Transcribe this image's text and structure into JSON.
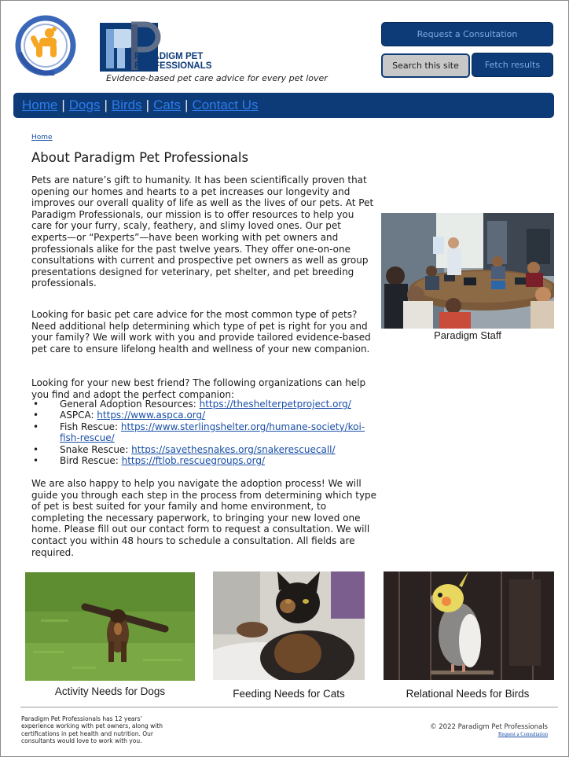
{
  "header": {
    "brand_line1": "PARADIGM PET",
    "brand_line2": "PROFESSIONALS",
    "tagline": "Evidence-based pet care advice for every pet lover",
    "request_button": "Request a Consultation",
    "search_button": "Search this site",
    "fetch_button": "Fetch results"
  },
  "nav": {
    "items": [
      "Home",
      "Dogs",
      "Birds",
      "Cats",
      "Contact Us"
    ],
    "separator": "|"
  },
  "main": {
    "breadcrumb": "Home",
    "title": "About Paradigm Pet Professionals",
    "paragraph1": "Pets are nature’s gift to humanity. It has been scientifically proven that opening our homes and hearts to a pet increases our longevity and improves our overall quality of life as well as the lives of our pets. At Pet Paradigm Professionals, our mission is to offer resources to help you care for your furry, scaly, feathery, and slimy loved ones. Our pet experts—or “Pexperts”—have been working with pet owners and professionals alike for the past twelve years. They offer one-on-one consultations with current and prospective pet owners as well as group presentations designed for veterinary, pet shelter, and pet breeding professionals.",
    "paragraph2": "Looking for basic pet care advice for the most common type of pets? Need additional help determining which type of pet is right for you and your family? We will work with you and provide tailored evidence-based pet care to ensure lifelong health and wellness of your new companion.",
    "paragraph3": "Looking for your new best friend? The following organizations can help you find and adopt the perfect companion:",
    "bullet": "•",
    "organizations": [
      {
        "label": "General Adoption Resources: ",
        "url": "https://theshelterpetproject.org/"
      },
      {
        "label": "ASPCA: ",
        "url": "https://www.aspca.org/"
      },
      {
        "label": "Fish Rescue: ",
        "url": "https://www.sterlingshelter.org/humane-society/koi-fish-rescue/"
      },
      {
        "label": "Snake Rescue: ",
        "url": "https://savethesnakes.org/snakerescuecall/"
      },
      {
        "label": "Bird Rescue: ",
        "url": "https://ftlob.rescuegroups.org/"
      }
    ],
    "paragraph4": "We are also happy to help you navigate the adoption process! We will guide you through each step in the process from determining which type of pet is best suited for your family and home environment, to completing the necessary paperwork, to bringing your new loved one home. Please fill out our contact form to request a consultation. We will contact you within 48 hours to schedule a consultation. All fields are required."
  },
  "staff": {
    "caption": "Paradigm Staff"
  },
  "gallery": {
    "dogs_caption": "Activity Needs for Dogs",
    "cats_caption": "Feeding Needs for Cats",
    "birds_caption": "Relational Needs for Birds"
  },
  "footer": {
    "about": "Paradigm Pet Professionals has 12 years’ experience working with pet owners, along with certifications in pet health and nutrition. Our consultants would love to work with you.",
    "copyright": "© 2022 Paradigm Pet Professionals",
    "consult_link": "Request a Consultation"
  },
  "colors": {
    "brand_navy": "#0d3b78",
    "link_blue": "#2e7be8",
    "logo_orange": "#f5a623",
    "logo_blue": "#2f62b8"
  }
}
